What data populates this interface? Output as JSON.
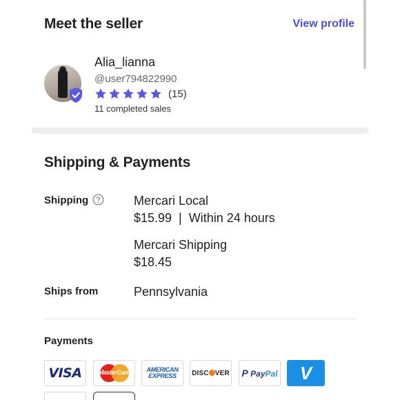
{
  "seller": {
    "section_title": "Meet the seller",
    "view_profile": "View profile",
    "name": "Alia_lianna",
    "handle": "@user794822990",
    "rating_stars": 5,
    "rating_count": "(15)",
    "sales": "11 completed sales",
    "star_color": "#5a57e0",
    "badge_color": "#5a57e0"
  },
  "shipping": {
    "section_title": "Shipping & Payments",
    "shipping_label": "Shipping",
    "options": [
      {
        "name": "Mercari Local",
        "detail": "$15.99  |  Within 24 hours"
      },
      {
        "name": "Mercari Shipping",
        "detail": "$18.45"
      }
    ],
    "ships_from_label": "Ships from",
    "ships_from": "Pennsylvania"
  },
  "payments": {
    "label": "Payments",
    "methods": [
      {
        "name": "VISA",
        "icon": "visa-logo-icon"
      },
      {
        "name": "MasterCard",
        "icon": "mastercard-logo-icon"
      },
      {
        "name": "AMERICAN EXPRESS",
        "icon": "amex-logo-icon",
        "lines": [
          "AMERICAN",
          "EXPRESS"
        ]
      },
      {
        "name": "DISCOVER",
        "icon": "discover-logo-icon",
        "parts": [
          "DISC",
          "VER"
        ]
      },
      {
        "name": "PayPal",
        "icon": "paypal-logo-icon",
        "parts": [
          "Pay",
          "Pal"
        ]
      },
      {
        "name": "V",
        "icon": "venmo-logo-icon"
      }
    ]
  }
}
